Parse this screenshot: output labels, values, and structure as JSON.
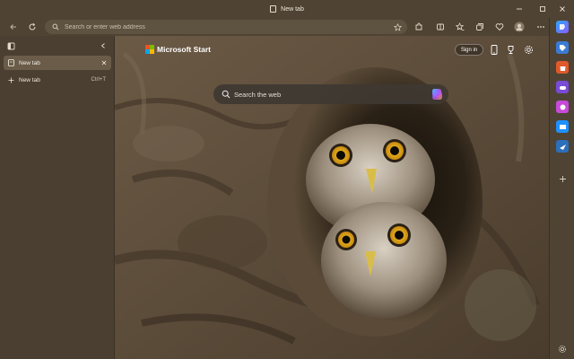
{
  "window": {
    "title": "New tab"
  },
  "toolbar": {
    "address_placeholder": "Search or enter web address"
  },
  "sidebar": {
    "tabs": [
      {
        "label": "New tab",
        "active": true
      }
    ],
    "new_tab": {
      "label": "New tab",
      "shortcut": "Ctrl+T"
    }
  },
  "page": {
    "brand": "Microsoft Start",
    "signin_label": "Sign in",
    "search_placeholder": "Search the web"
  },
  "colors": {
    "chrome": "#4f4433",
    "sidebar": "#4a3f30",
    "active_tab": "#6a5c48"
  },
  "icons": [
    "back-icon",
    "refresh-icon",
    "search-icon",
    "favorites-star-icon",
    "extensions-icon",
    "split-screen-icon",
    "collections-icon",
    "profile-avatar-icon",
    "more-icon",
    "copilot-icon",
    "phone-icon",
    "rewards-trophy-icon",
    "settings-gear-icon"
  ]
}
